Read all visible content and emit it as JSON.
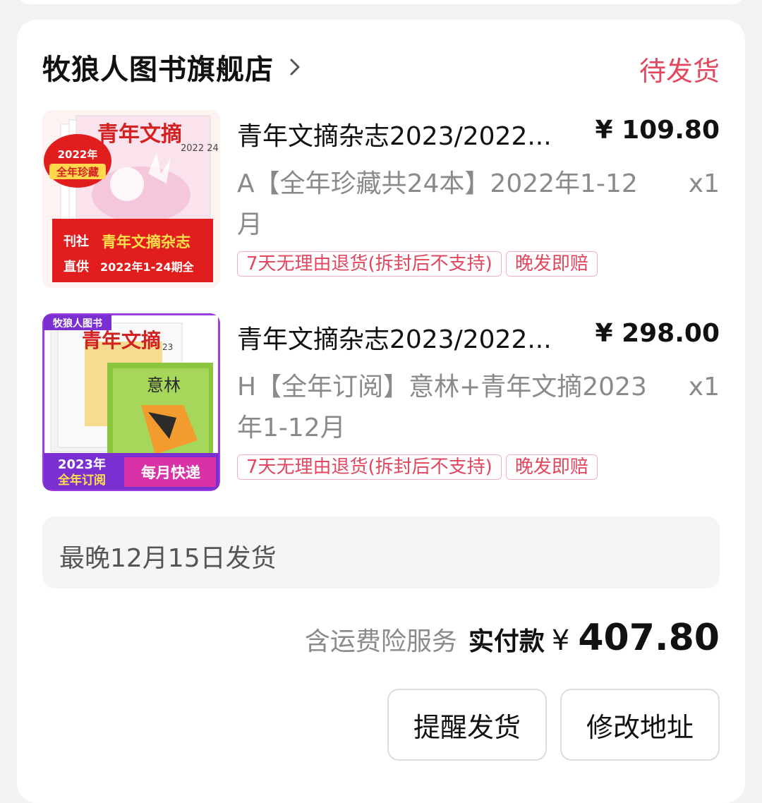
{
  "shop": {
    "name": "牧狼人图书旗舰店",
    "status": "待发货"
  },
  "items": [
    {
      "title": "青年文摘杂志2023/2022...",
      "price": "¥ 109.80",
      "spec": "A【全年珍藏共24本】2022年1-12月",
      "qty": "x1",
      "tags": [
        "7天无理由退货(拆封后不支持)",
        "晚发即赔"
      ],
      "image": {
        "magazine_title": "青年文摘",
        "issue": "2022 24",
        "badge_top": "2022年",
        "badge_bottom": "全年珍藏",
        "banner_left_1": "刊社",
        "banner_left_2": "直供",
        "banner_title": "青年文摘杂志",
        "banner_sub": "2022年1-24期全",
        "accent": "#e11d1d"
      }
    },
    {
      "title": "青年文摘杂志2023/2022...",
      "price": "¥ 298.00",
      "spec": "H【全年订阅】意林+青年文摘2023年1-12月",
      "qty": "x1",
      "tags": [
        "7天无理由退货(拆封后不支持)",
        "晚发即赔"
      ],
      "image": {
        "corner_label": "牧狼人图书",
        "magazine_title": "青年文摘",
        "second_title": "意林",
        "issue": "23",
        "banner_left_1": "2023年",
        "banner_left_2": "全年订阅",
        "banner_right": "每月快递",
        "accent": "#7a2fd1"
      }
    }
  ],
  "shipping": {
    "notice": "最晚12月15日发货"
  },
  "summary": {
    "insurance": "含运费险服务",
    "paid_label": "实付款",
    "currency": "¥",
    "total": "407.80"
  },
  "actions": {
    "remind": "提醒发货",
    "change_address": "修改地址"
  },
  "colors": {
    "status_red": "#e2475f",
    "tag_border": "#f0b3bd",
    "background": "#f2f2f4"
  },
  "icons": {
    "shop_chevron": "chevron-right-icon"
  }
}
